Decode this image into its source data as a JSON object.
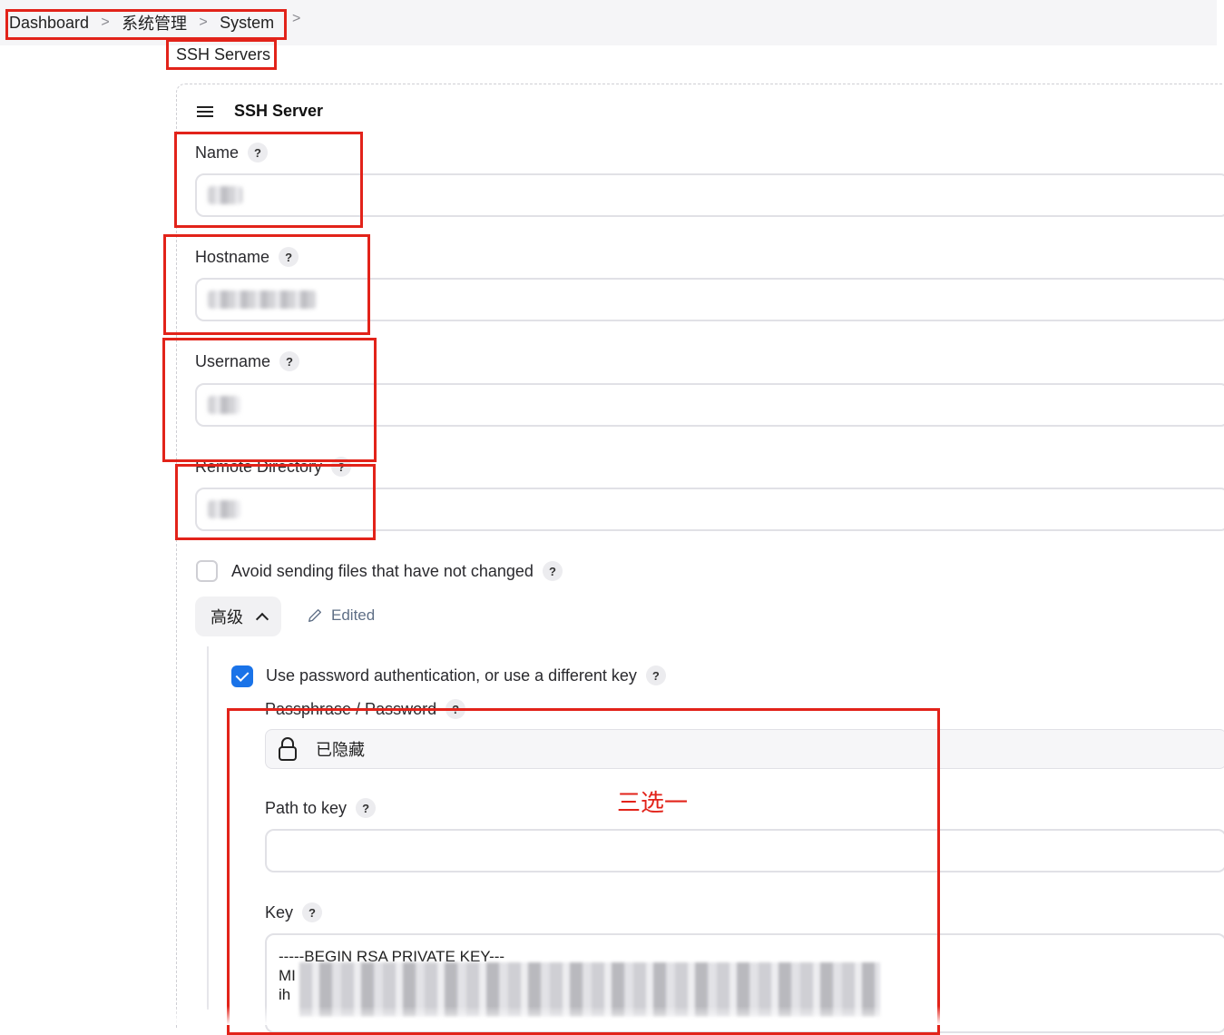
{
  "breadcrumb": {
    "items": [
      "Dashboard",
      "系统管理",
      "System"
    ],
    "current": "SSH Servers"
  },
  "section": {
    "title": "SSH Server"
  },
  "fields": {
    "name": {
      "label": "Name",
      "help": "?"
    },
    "hostname": {
      "label": "Hostname",
      "help": "?"
    },
    "username": {
      "label": "Username",
      "help": "?"
    },
    "remote_directory": {
      "label": "Remote Directory",
      "help": "?"
    }
  },
  "avoid_sending": {
    "label": "Avoid sending files that have not changed",
    "help": "?",
    "checked": false
  },
  "advanced": {
    "label": "高级",
    "edited_label": "Edited"
  },
  "use_password": {
    "label": "Use password authentication, or use a different key",
    "help": "?",
    "checked": true
  },
  "passphrase": {
    "label": "Passphrase / Password",
    "help": "?",
    "value": "已隐藏"
  },
  "path_to_key": {
    "label": "Path to key",
    "help": "?",
    "value": ""
  },
  "key": {
    "label": "Key",
    "help": "?",
    "lines": [
      "-----BEGIN RSA PRIVATE KEY---",
      "MI",
      "ih"
    ]
  },
  "annotation": {
    "text": "三选一",
    "color": "#e2231a"
  },
  "colors": {
    "accent": "#1a73e8",
    "annotation_red": "#e2231a"
  }
}
